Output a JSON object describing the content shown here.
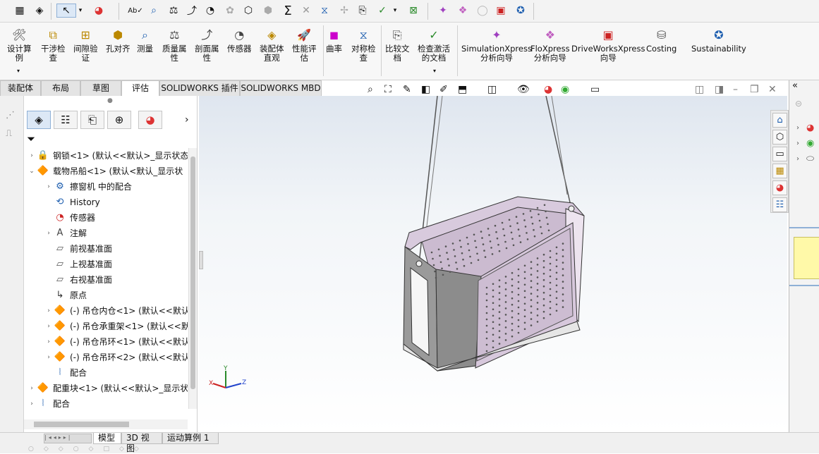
{
  "quickbar": {
    "icons": [
      "select-icon",
      "appearance-icon",
      "spelling-icon",
      "measure-icon",
      "mass-icon",
      "sketch-icon",
      "gauge-icon",
      "check-icon",
      "sum-icon",
      "curvature-icon",
      "error-icon"
    ],
    "select_label": "↖"
  },
  "command_manager": {
    "items": [
      {
        "label": "设计算\n例"
      },
      {
        "label": "干涉检\n查"
      },
      {
        "label": "间隙验\n证"
      },
      {
        "label": "孔对齐"
      },
      {
        "label": "测量"
      },
      {
        "label": "质量属\n性"
      },
      {
        "label": "剖面属\n性"
      },
      {
        "label": "传感器"
      },
      {
        "label": "装配体\n直观"
      },
      {
        "label": "性能评\n估"
      },
      {
        "label": "曲率"
      },
      {
        "label": "对称检\n查"
      },
      {
        "label": "比较文\n档"
      },
      {
        "label": "检查激活\n的文档"
      },
      {
        "label": "SimulationXpress\n分析向导"
      },
      {
        "label": "FloXpress\n分析向导"
      },
      {
        "label": "DriveWorksXpress\n向导"
      },
      {
        "label": "Costing"
      },
      {
        "label": "Sustainability"
      }
    ]
  },
  "tabs": [
    {
      "label": "装配体"
    },
    {
      "label": "布局"
    },
    {
      "label": "草图"
    },
    {
      "label": "评估"
    },
    {
      "label": "SOLIDWORKS 插件"
    },
    {
      "label": "SOLIDWORKS MBD"
    }
  ],
  "tree": {
    "nodes": [
      {
        "label": "钢锁<1> (默认<<默认>_显示状态",
        "arrow": "›"
      },
      {
        "label": "载物吊船<1> (默认<默认_显示状",
        "arrow": "⌄"
      },
      {
        "label": "擦窗机 中的配合",
        "arrow": "›"
      },
      {
        "label": "History",
        "arrow": ""
      },
      {
        "label": "传感器",
        "arrow": ""
      },
      {
        "label": "注解",
        "arrow": "›"
      },
      {
        "label": "前视基准面",
        "arrow": ""
      },
      {
        "label": "上视基准面",
        "arrow": ""
      },
      {
        "label": "右视基准面",
        "arrow": ""
      },
      {
        "label": "原点",
        "arrow": ""
      },
      {
        "label": "(-) 吊仓内仓<1> (默认<<默认",
        "arrow": "›"
      },
      {
        "label": "(-) 吊仓承重架<1> (默认<<默",
        "arrow": "›"
      },
      {
        "label": "(-) 吊仓吊环<1> (默认<<默认",
        "arrow": "›"
      },
      {
        "label": "(-) 吊仓吊环<2> (默认<<默认",
        "arrow": "›"
      },
      {
        "label": "配合",
        "arrow": ""
      },
      {
        "label": "配重块<1> (默认<<默认>_显示状",
        "arrow": "›"
      },
      {
        "label": "配合",
        "arrow": "›"
      }
    ]
  },
  "triad": {
    "x": "X",
    "y": "Y",
    "z": "Z"
  },
  "bottom_tabs": [
    {
      "label": "模型"
    },
    {
      "label": "3D 视图"
    },
    {
      "label": "运动算例 1"
    }
  ],
  "taskpane": {
    "collapse": "«"
  },
  "colors": {
    "accent": "#2b5fa8",
    "basket": "#ccbdd1",
    "frame": "#8c8c8c"
  }
}
